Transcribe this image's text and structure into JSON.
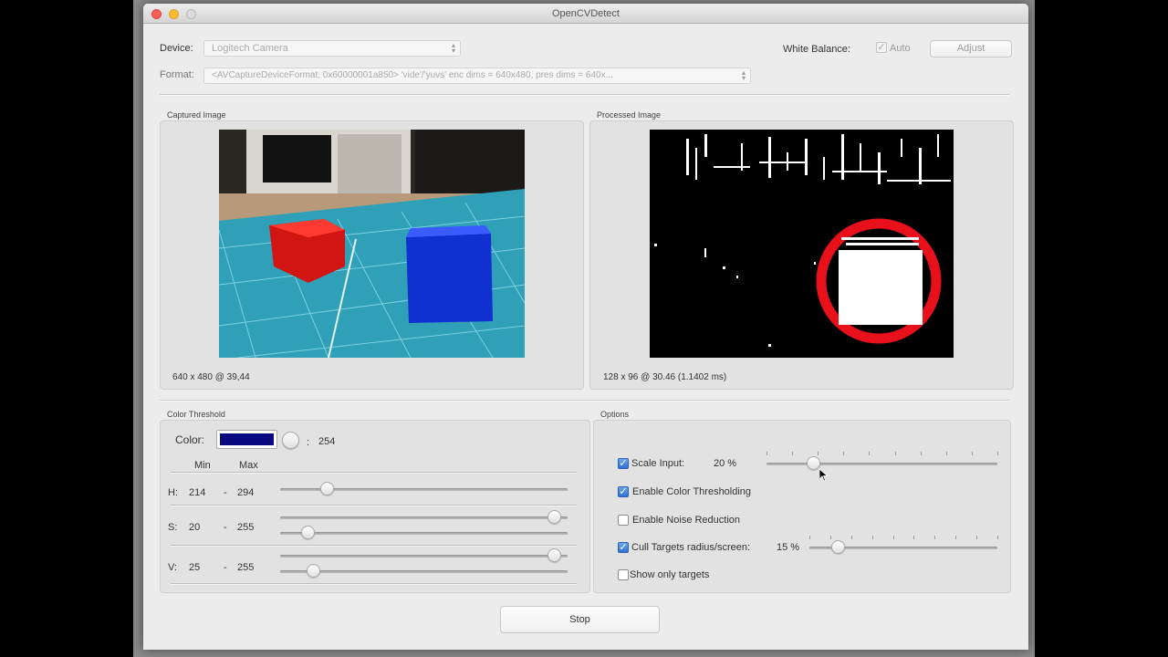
{
  "window": {
    "title": "OpenCVDetect"
  },
  "device": {
    "label": "Device:",
    "value": "Logitech Camera"
  },
  "format": {
    "label": "Format:",
    "value": "<AVCaptureDeviceFormat: 0x60000001a850> 'vide'/'yuvs' enc dims = 640x480, pres dims = 640x..."
  },
  "white_balance": {
    "label": "White Balance:",
    "auto_label": "Auto",
    "auto_checked": true,
    "adjust_label": "Adjust"
  },
  "captured": {
    "title": "Captured Image",
    "info": "640 x 480 @ 39,44"
  },
  "processed": {
    "title": "Processed Image",
    "info": "128 x 96 @ 30.46 (1.1402 ms)"
  },
  "threshold": {
    "title": "Color Threshold",
    "color_label": "Color:",
    "swatch_color": "#0a0a80",
    "color_value": "254",
    "colon": ":",
    "min_header": "Min",
    "max_header": "Max",
    "dash": "-",
    "h": {
      "label": "H:",
      "min": "214",
      "max": "294",
      "slider": 0.17
    },
    "s": {
      "label": "S:",
      "min": "20",
      "max": "255",
      "max_slider": 1.0,
      "min_slider": 0.1
    },
    "v": {
      "label": "V:",
      "min": "25",
      "max": "255",
      "max_slider": 1.0,
      "min_slider": 0.12
    }
  },
  "options": {
    "title": "Options",
    "scale_input": {
      "label": "Scale Input:",
      "checked": true,
      "value": "20 %",
      "slider": 0.2
    },
    "color_thresholding": {
      "label": "Enable Color Thresholding",
      "checked": true
    },
    "noise_reduction": {
      "label": "Enable Noise Reduction",
      "checked": false
    },
    "cull_targets": {
      "label": "Cull Targets radius/screen:",
      "checked": true,
      "value": "15 %",
      "slider": 0.15
    },
    "show_only_targets": {
      "label": "Show only targets",
      "checked": false
    }
  },
  "stop_button": {
    "label": "Stop"
  },
  "colors": {
    "accent": "#2e72d6",
    "target_ring": "#e8101a"
  }
}
